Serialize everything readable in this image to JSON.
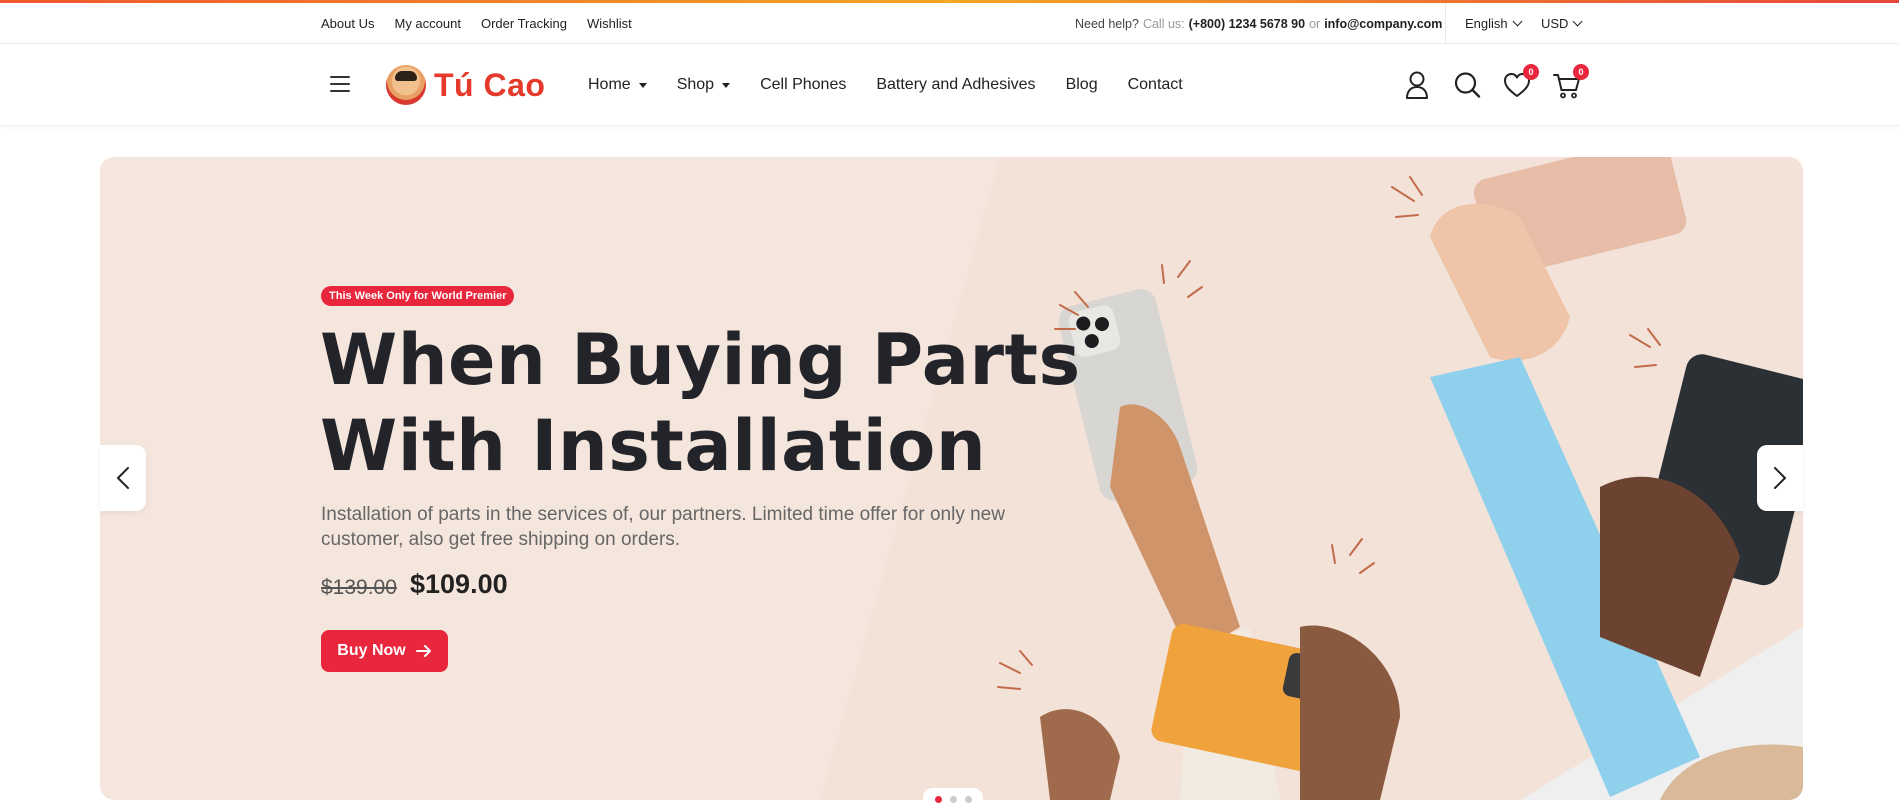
{
  "topbar": {
    "links": [
      "About Us",
      "My account",
      "Order Tracking",
      "Wishlist"
    ],
    "help_prefix": "Need help?",
    "call_label": "Call us:",
    "phone": "(+800) 1234 5678 90",
    "or_label": "or",
    "email": "info@company.com",
    "language": "English",
    "currency": "USD"
  },
  "header": {
    "brand": "Tú Cao",
    "nav": [
      {
        "label": "Home",
        "has_dropdown": true
      },
      {
        "label": "Shop",
        "has_dropdown": true
      },
      {
        "label": "Cell Phones",
        "has_dropdown": false
      },
      {
        "label": "Battery and Adhesives",
        "has_dropdown": false
      },
      {
        "label": "Blog",
        "has_dropdown": false
      },
      {
        "label": "Contact",
        "has_dropdown": false
      }
    ],
    "wishlist_count": "0",
    "cart_count": "0",
    "icons": [
      "account-icon",
      "search-icon",
      "heart-icon",
      "cart-icon"
    ]
  },
  "hero": {
    "tag": "This Week Only for World Premier",
    "title_line1": "When Buying Parts",
    "title_line2": "With Installation",
    "description": "Installation of parts in the services of, our partners. Limited time offer for only new customer, also get free shipping on orders.",
    "price_old": "$139.00",
    "price_new": "$109.00",
    "button_label": "Buy Now",
    "slides_total": 3,
    "active_slide": 1
  },
  "colors": {
    "accent": "#e8263c",
    "hero_bg": "#f5e6dd",
    "brand": "#e5392c",
    "title": "#23242a"
  }
}
